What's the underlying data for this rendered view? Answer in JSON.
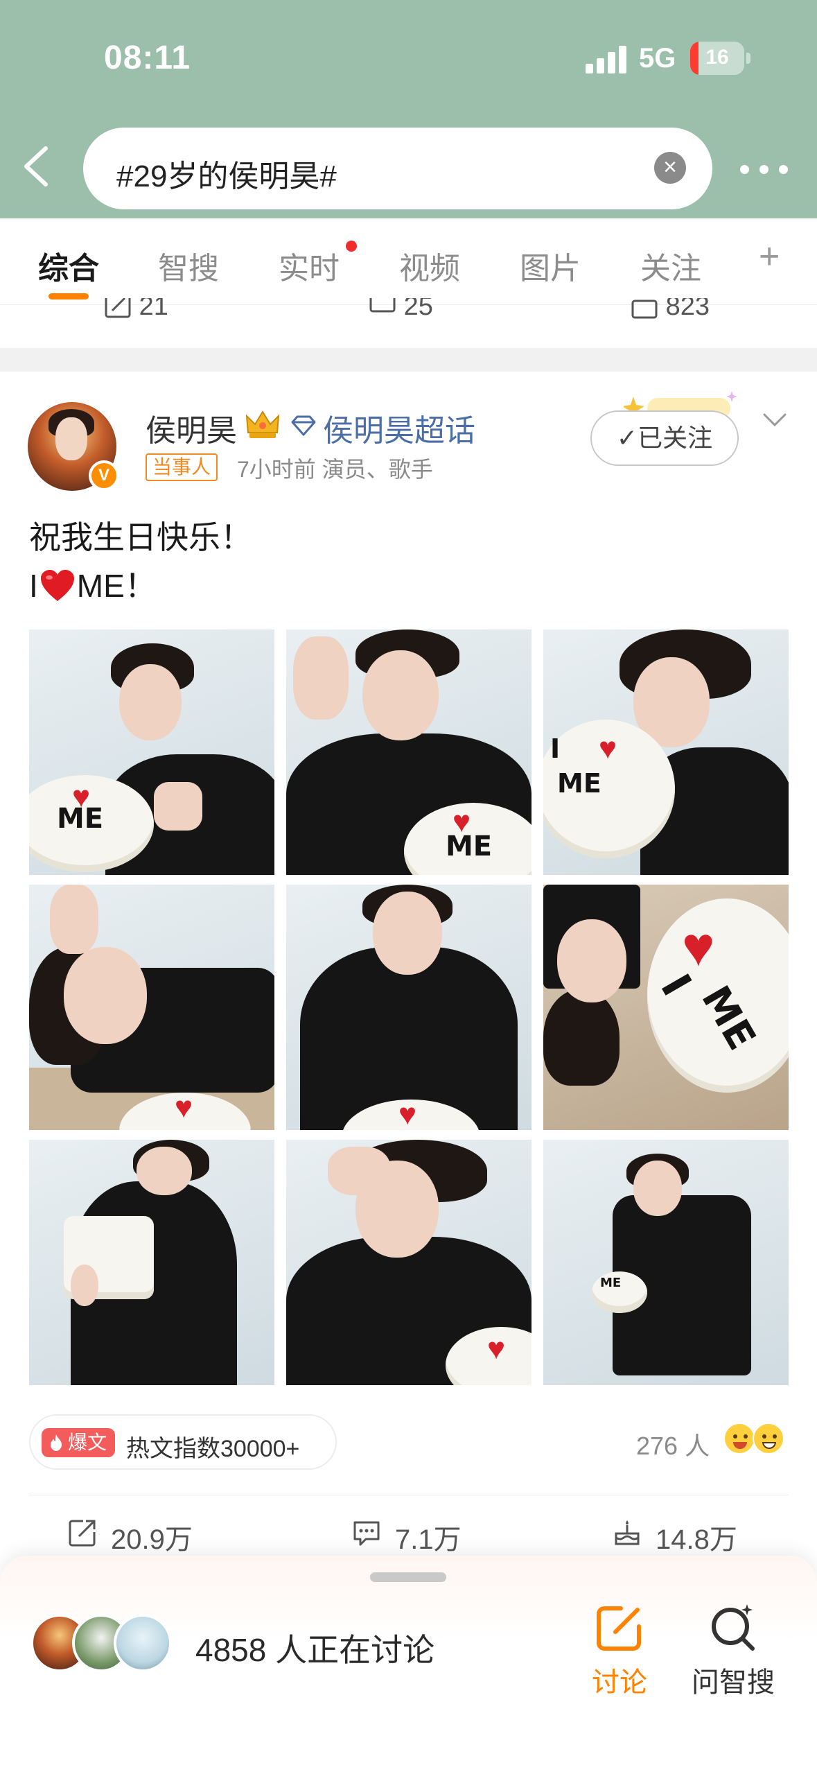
{
  "status_bar": {
    "time": "08:11",
    "network": "5G",
    "battery": "16"
  },
  "search": {
    "query": "#29岁的侯明昊#"
  },
  "tabs": [
    {
      "label": "综合",
      "active": true
    },
    {
      "label": "智搜"
    },
    {
      "label": "实时",
      "has_dot": true
    },
    {
      "label": "视频"
    },
    {
      "label": "图片"
    },
    {
      "label": "关注"
    }
  ],
  "prev_post_actions": {
    "reposts": "21",
    "comments": "25",
    "likes": "823"
  },
  "post": {
    "author": "侯明昊",
    "super_topic": "侯明昊超话",
    "role_badge": "当事人",
    "meta": "7小时前  演员、歌手",
    "follow_label": "已关注",
    "text_line1": "祝我生日快乐！",
    "text_line2_before": "I",
    "text_line2_after": "ME！",
    "hot_tag": "爆文",
    "hot_text": "热文指数30000+",
    "reactions_count": "276 人",
    "reposts": "20.9万",
    "comments": "7.1万",
    "likes": "14.8万"
  },
  "bottom_sheet": {
    "discuss_count_text": "4858 人正在讨论",
    "discuss_label": "讨论",
    "ask_label": "问智搜"
  },
  "colors": {
    "accent": "#ff8200",
    "header_bg": "#9cbfab",
    "link": "#4b6ea8"
  }
}
